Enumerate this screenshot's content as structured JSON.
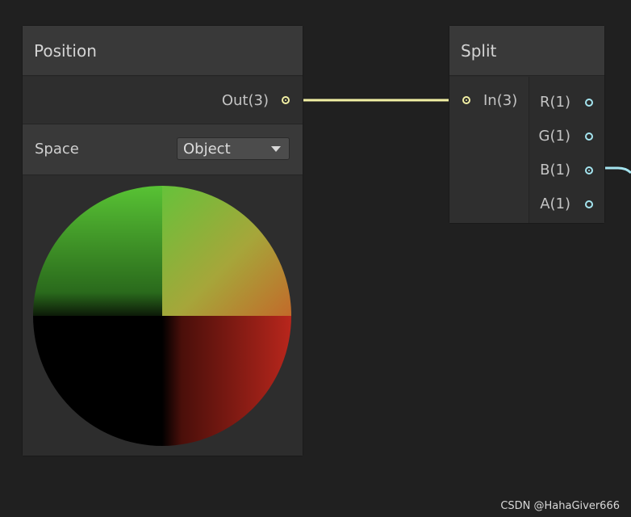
{
  "position_node": {
    "title": "Position",
    "output_label": "Out(3)",
    "space_label": "Space",
    "space_value": "Object"
  },
  "split_node": {
    "title": "Split",
    "input_label": "In(3)",
    "outputs": [
      {
        "label": "R(1)",
        "connected": false
      },
      {
        "label": "G(1)",
        "connected": false
      },
      {
        "label": "B(1)",
        "connected": true
      },
      {
        "label": "A(1)",
        "connected": false
      }
    ]
  },
  "colors": {
    "vector3_port": "#f2f0a4",
    "float_port": "#a4e4ef",
    "canvas": "#202020"
  },
  "watermark": "CSDN @HahaGiver666"
}
